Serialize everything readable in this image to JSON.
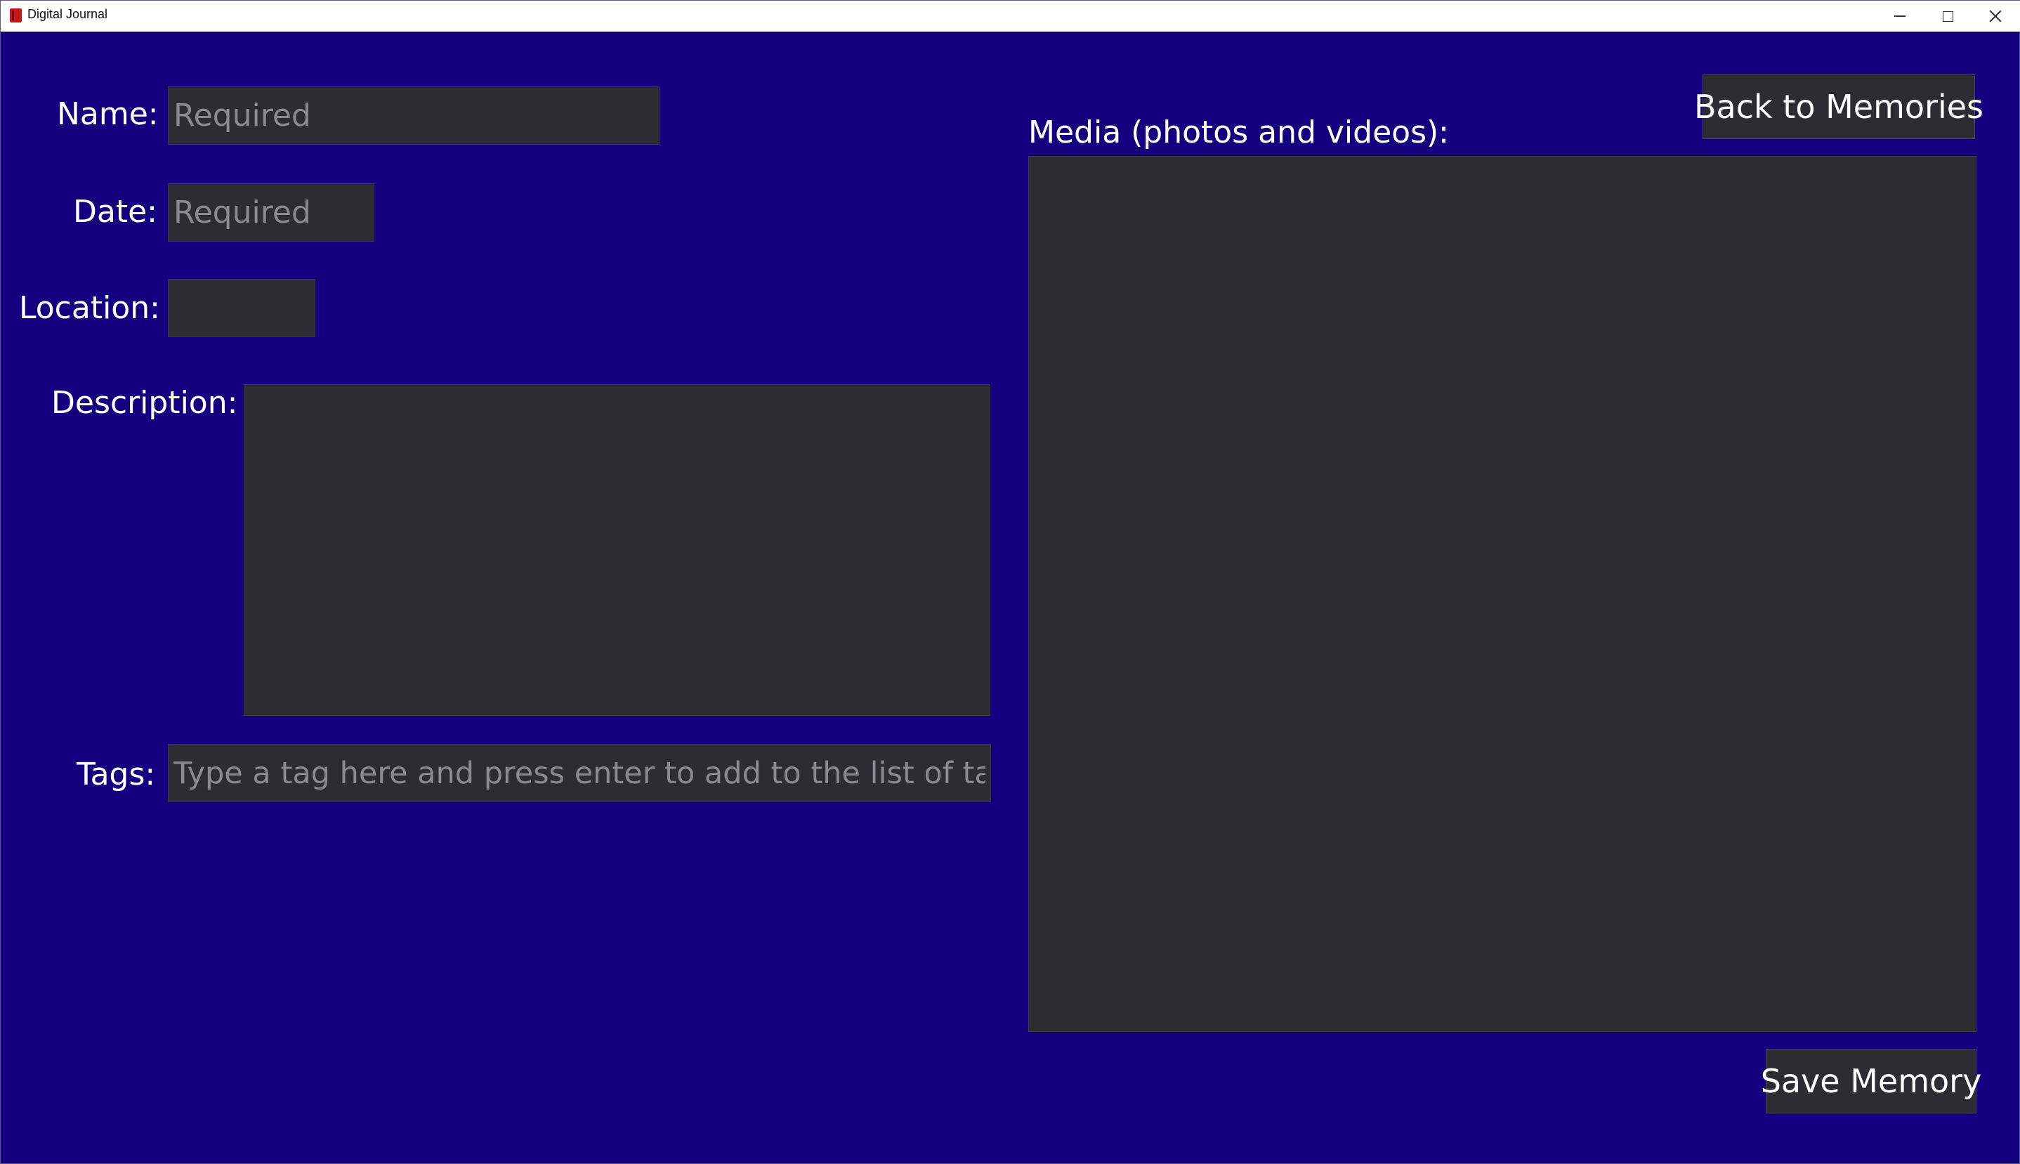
{
  "window": {
    "title": "Digital Journal",
    "icon": "journal-app-icon",
    "controls": {
      "minimize": "minimize-icon",
      "maximize": "maximize-icon",
      "close": "close-icon"
    }
  },
  "form": {
    "name_label": "Name:",
    "name_placeholder": "Required",
    "name_value": "",
    "date_label": "Date:",
    "date_placeholder": "Required",
    "date_value": "",
    "location_label": "Location:",
    "location_value": "",
    "description_label": "Description:",
    "description_value": "",
    "tags_label": "Tags:",
    "tags_placeholder": "Type a tag here and press enter to add to the list of tags",
    "tags_value": ""
  },
  "media": {
    "label": "Media (photos and videos):"
  },
  "actions": {
    "back_label": "Back to Memories",
    "save_label": "Save Memory"
  },
  "colors": {
    "background": "#14007f",
    "field": "#2e2c33",
    "text": "#ffffff",
    "placeholder": "#8a8a90"
  }
}
